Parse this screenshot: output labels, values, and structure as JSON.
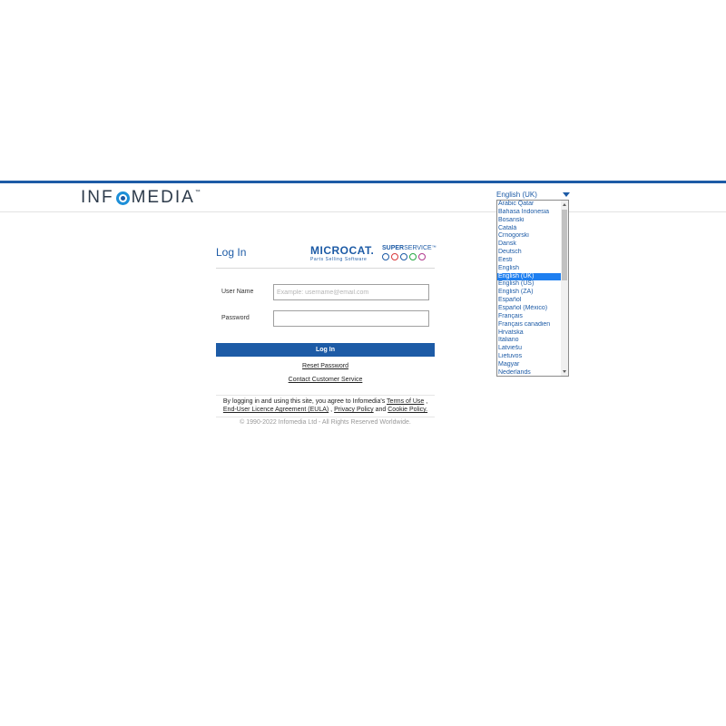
{
  "header": {
    "logo_left": "INF",
    "logo_right": "MEDIA",
    "logo_tm": "™",
    "language_selected": "English (UK)"
  },
  "language_options": [
    "Arabic Qatar",
    "Bahasa Indonesia",
    "Bosanski",
    "Català",
    "Crnogorski",
    "Dansk",
    "Deutsch",
    "Eesti",
    "English",
    "English (UK)",
    "English (US)",
    "English (ZA)",
    "Español",
    "Español (México)",
    "Français",
    "Français canadien",
    "Hrvatska",
    "Italiano",
    "Latviešu",
    "Lietuvos",
    "Magyar",
    "Nederlands"
  ],
  "login": {
    "title": "Log In",
    "microcat_name": "MICROCAT.",
    "microcat_tagline": "Parts Selling Software",
    "superservice_bold": "SUPER",
    "superservice_rest": "SERVICE",
    "superservice_tm": "™",
    "username_label": "User Name",
    "username_placeholder": "Example: username@email.com",
    "password_label": "Password",
    "login_button": "Log In",
    "reset_password": "Reset Password",
    "contact_service": "Contact Customer Service"
  },
  "footer": {
    "terms_prefix": "By logging in and using this site, you agree to Infomedia's",
    "terms_of_use": "Terms of Use",
    "eula": "End-User Licence Agreement (EULA)",
    "privacy_policy": "Privacy Policy",
    "and": "and",
    "cookie_policy": "Cookie Policy.",
    "copyright": "© 1990-2022 Infomedia Ltd - All Rights Reserved Worldwide."
  },
  "colors": {
    "brand_blue": "#1d5ba6",
    "selection_blue": "#1e7ff0",
    "superservice_icons": [
      "#1d5ba6",
      "#d9393b",
      "#1d5ba6",
      "#27a844",
      "#b03a8e"
    ]
  }
}
